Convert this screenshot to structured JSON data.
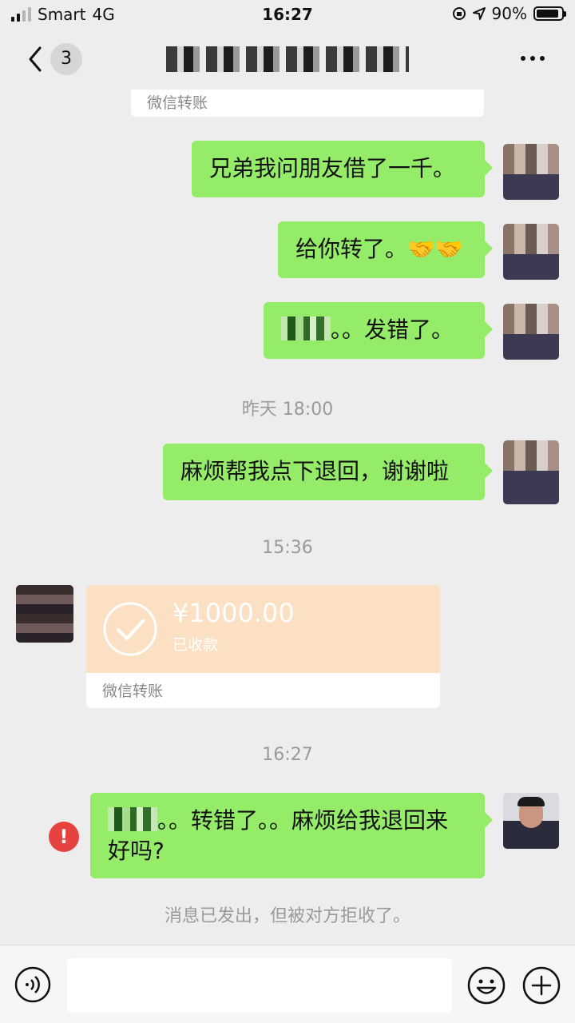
{
  "status_bar": {
    "carrier": "Smart",
    "network": "4G",
    "time": "16:27",
    "battery": "90%",
    "battery_level": 0.9
  },
  "nav": {
    "unread_count": "3"
  },
  "messages": {
    "prev_transfer_label": "微信转账",
    "m1": "兄弟我问朋友借了一千。",
    "m2": "给你转了。",
    "m2_emoji": "🤝🤝",
    "m3": "。。发错了。",
    "ts1": "昨天 18:00",
    "m4": "麻烦帮我点下退回，谢谢啦",
    "ts2": "15:36",
    "transfer": {
      "amount": "¥1000.00",
      "status": "已收款",
      "label": "微信转账"
    },
    "ts3": "16:27",
    "m5": "。。转错了。。麻烦给我退回来好吗?",
    "error_mark": "!",
    "system_note": "消息已发出，但被对方拒收了。"
  },
  "input": {
    "value": "",
    "placeholder": ""
  },
  "colors": {
    "bubble": "#95ec69",
    "transfer": "#fbe0c4",
    "error": "#e64340",
    "background": "#ededed"
  }
}
